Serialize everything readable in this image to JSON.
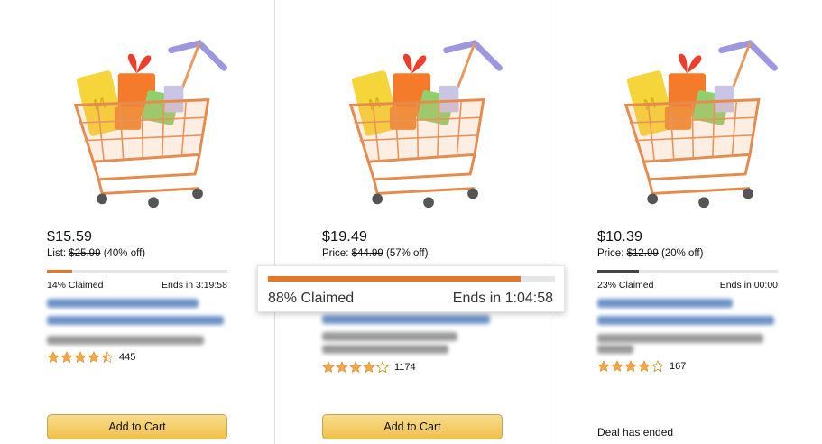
{
  "colors": {
    "star": "#f3a847",
    "bar_low": "#e3782a",
    "bar_ended": "#444444",
    "bar_track": "#e3e6e6",
    "button": "#f0c14b"
  },
  "products": [
    {
      "image_icon": "shopping-cart-illustration",
      "price": "$15.59",
      "list_prefix": "List:",
      "list_price": "$25.99",
      "discount": "(40% off)",
      "claimed_fraction": 0.14,
      "claimed_text": "14% Claimed",
      "ends_text": "Ends in 3:19:58",
      "rating": 4.5,
      "review_count": "445",
      "button_label": "Add to Cart"
    },
    {
      "image_icon": "shopping-cart-illustration",
      "price": "$19.49",
      "list_prefix": "Price:",
      "list_price": "$44.99",
      "discount": "(57% off)",
      "claimed_fraction": 0.88,
      "claimed_text": "88% Claimed",
      "ends_text": "Ends in 1:04:58",
      "rating": 4.0,
      "review_count": "1174",
      "button_label": "Add to Cart"
    },
    {
      "image_icon": "shopping-cart-illustration",
      "price": "$10.39",
      "list_prefix": "Price:",
      "list_price": "$12.99",
      "discount": "(20% off)",
      "claimed_fraction": 0.23,
      "claimed_text": "23% Claimed",
      "ends_text": "Ends in 00:00",
      "rating": 4.0,
      "review_count": "167",
      "status_text": "Deal has ended"
    }
  ],
  "callout": {
    "claimed_fraction": 0.88,
    "claimed_text": "88% Claimed",
    "ends_text": "Ends in 1:04:58"
  }
}
